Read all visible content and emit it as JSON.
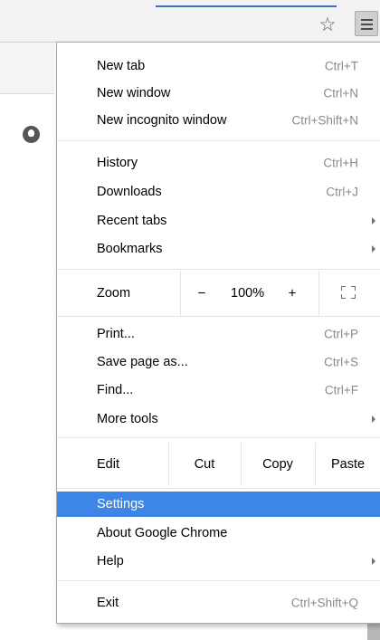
{
  "menu": {
    "sections": {
      "new": [
        {
          "label": "New tab",
          "shortcut": "Ctrl+T"
        },
        {
          "label": "New window",
          "shortcut": "Ctrl+N"
        },
        {
          "label": "New incognito window",
          "shortcut": "Ctrl+Shift+N"
        }
      ],
      "history": [
        {
          "label": "History",
          "shortcut": "Ctrl+H"
        },
        {
          "label": "Downloads",
          "shortcut": "Ctrl+J"
        },
        {
          "label": "Recent tabs"
        },
        {
          "label": "Bookmarks"
        }
      ],
      "tools": [
        {
          "label": "Print...",
          "shortcut": "Ctrl+P"
        },
        {
          "label": "Save page as...",
          "shortcut": "Ctrl+S"
        },
        {
          "label": "Find...",
          "shortcut": "Ctrl+F"
        },
        {
          "label": "More tools"
        }
      ],
      "settings": [
        {
          "label": "Settings"
        },
        {
          "label": "About Google Chrome"
        },
        {
          "label": "Help"
        }
      ],
      "exit": {
        "label": "Exit",
        "shortcut": "Ctrl+Shift+Q"
      }
    },
    "zoom": {
      "label": "Zoom",
      "minus": "−",
      "value": "100%",
      "plus": "+"
    },
    "edit": {
      "label": "Edit",
      "cut": "Cut",
      "copy": "Copy",
      "paste": "Paste"
    }
  },
  "colors": {
    "highlight": "#3d86e6",
    "shortcut": "#8a8a8a"
  },
  "icons": {
    "star": "star-icon",
    "menu": "hamburger-menu-icon",
    "profile": "profile-icon",
    "fullscreen": "fullscreen-icon"
  }
}
